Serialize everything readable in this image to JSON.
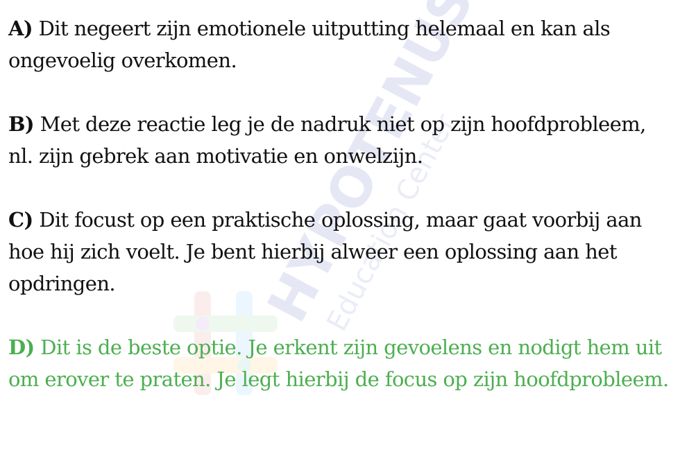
{
  "answers": [
    {
      "letter": "A)",
      "text": "Dit negeert zijn emotionele uitputting helemaal en kan als ongevoelig overkomen.",
      "correct": false
    },
    {
      "letter": "B)",
      "text": "Met deze reactie leg je de nadruk niet op zijn hoofdprobleem, nl. zijn gebrek aan motivatie en onwelzijn.",
      "correct": false
    },
    {
      "letter": "C)",
      "text": "Dit focust op een praktische oplossing, maar gaat voorbij aan hoe hij zich voelt. Je bent hierbij alweer een oplossing aan het opdringen.",
      "correct": false
    },
    {
      "letter": "D)",
      "text": "Dit is de beste optie. Je erkent zijn gevoelens en nodigt hem uit om erover te praten. Je legt hierbij de focus op zijn hoofdprobleem.",
      "correct": true
    }
  ],
  "watermark": {
    "title": "HYPOTENUSE",
    "subtitle": "Education Center"
  },
  "colors": {
    "text": "#111111",
    "correct": "#4caf50"
  }
}
